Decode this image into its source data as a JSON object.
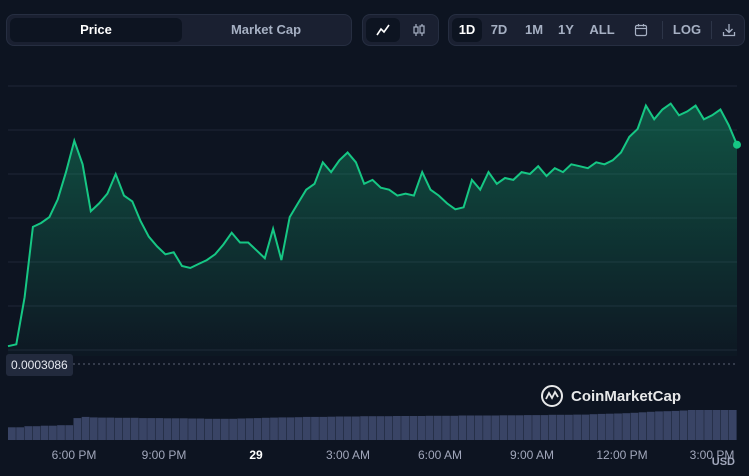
{
  "toolbar": {
    "metric_tabs": [
      "Price",
      "Market Cap"
    ],
    "active_metric": "Price",
    "chart_type_icons": [
      "line-chart-icon",
      "candlestick-icon"
    ],
    "ranges": [
      "1D",
      "7D",
      "1M",
      "1Y",
      "ALL"
    ],
    "active_range": "1D",
    "calendar_icon": "calendar-icon",
    "log_label": "LOG",
    "download_icon": "download-icon"
  },
  "colors": {
    "line": "#16c784",
    "background": "#0d1421",
    "grid": "#1f2637",
    "volume": "#48547c"
  },
  "chart_data": {
    "type": "area",
    "x_tick_labels": [
      "6:00 PM",
      "9:00 PM",
      "29",
      "3:00 AM",
      "6:00 AM",
      "9:00 AM",
      "12:00 PM",
      "3:00 PM"
    ],
    "x_tick_bold": "29",
    "reference_value_label": "0.0003086",
    "currency_label": "USD",
    "watermark": "CoinMarketCap",
    "grid": true,
    "series": [
      {
        "values": [
          0.0003087,
          0.0003088,
          0.0003112,
          0.0003148,
          0.000315,
          0.0003153,
          0.0003162,
          0.0003176,
          0.0003192,
          0.000318,
          0.0003156,
          0.000316,
          0.0003165,
          0.0003175,
          0.0003164,
          0.0003161,
          0.0003151,
          0.0003143,
          0.0003138,
          0.0003134,
          0.0003135,
          0.0003128,
          0.0003127,
          0.0003129,
          0.0003131,
          0.0003134,
          0.0003139,
          0.0003145,
          0.000314,
          0.000314,
          0.0003136,
          0.0003132,
          0.0003147,
          0.0003131,
          0.0003153,
          0.000316,
          0.0003167,
          0.000317,
          0.0003181,
          0.0003176,
          0.0003182,
          0.0003186,
          0.0003181,
          0.000317,
          0.0003172,
          0.0003168,
          0.0003167,
          0.0003164,
          0.0003165,
          0.0003164,
          0.0003176,
          0.0003167,
          0.0003164,
          0.000316,
          0.0003157,
          0.0003158,
          0.0003172,
          0.0003167,
          0.0003176,
          0.000317,
          0.0003173,
          0.0003172,
          0.0003176,
          0.0003175,
          0.0003179,
          0.0003174,
          0.0003178,
          0.0003176,
          0.000318,
          0.0003179,
          0.0003178,
          0.0003181,
          0.000318,
          0.0003182,
          0.0003186,
          0.0003194,
          0.0003198,
          0.000321,
          0.0003203,
          0.0003208,
          0.0003211,
          0.0003205,
          0.0003207,
          0.000321,
          0.0003203,
          0.0003205,
          0.0003208,
          0.00032,
          0.000319
        ]
      }
    ]
  },
  "volume_data": {
    "values": [
      0.55,
      0.55,
      0.6,
      0.6,
      0.62,
      0.62,
      0.64,
      0.64,
      0.95,
      1.0,
      0.98,
      0.97,
      0.97,
      0.96,
      0.96,
      0.96,
      0.95,
      0.95,
      0.95,
      0.94,
      0.94,
      0.94,
      0.93,
      0.93,
      0.92,
      0.92,
      0.92,
      0.92,
      0.93,
      0.94,
      0.95,
      0.96,
      0.97,
      0.98,
      0.98,
      0.99,
      1.0,
      1.0,
      1.0,
      1.01,
      1.02,
      1.02,
      1.02,
      1.03,
      1.03,
      1.03,
      1.03,
      1.04,
      1.04,
      1.04,
      1.04,
      1.05,
      1.05,
      1.05,
      1.05,
      1.06,
      1.06,
      1.06,
      1.06,
      1.06,
      1.07,
      1.07,
      1.07,
      1.08,
      1.08,
      1.08,
      1.09,
      1.09,
      1.09,
      1.1,
      1.1,
      1.12,
      1.13,
      1.14,
      1.15,
      1.16,
      1.18,
      1.2,
      1.22,
      1.24,
      1.25,
      1.26,
      1.28,
      1.3,
      1.3,
      1.3,
      1.3,
      1.3,
      1.3
    ]
  }
}
